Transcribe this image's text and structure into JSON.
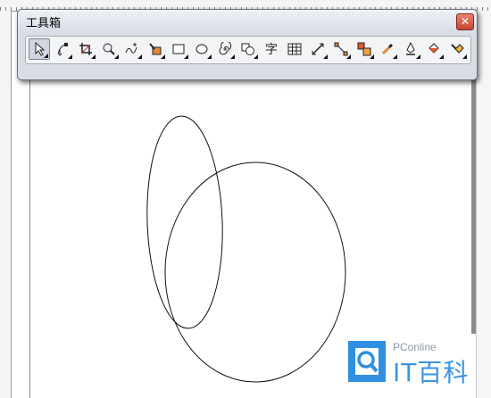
{
  "toolbox": {
    "title": "工具箱",
    "close_glyph": "✕",
    "text_tool_label": "字",
    "tools": [
      {
        "name": "pick-tool",
        "icon": "arrow-pointer-icon",
        "selected": true
      },
      {
        "name": "shape-tool",
        "icon": "shape-node-icon"
      },
      {
        "name": "crop-tool",
        "icon": "crop-icon"
      },
      {
        "name": "zoom-tool",
        "icon": "magnifier-icon"
      },
      {
        "name": "freehand-tool",
        "icon": "freehand-curve-icon"
      },
      {
        "name": "smart-fill-tool",
        "icon": "smart-fill-icon"
      },
      {
        "name": "rectangle-tool",
        "icon": "rectangle-icon"
      },
      {
        "name": "ellipse-tool",
        "icon": "ellipse-icon"
      },
      {
        "name": "spiral-tool",
        "icon": "spiral-icon"
      },
      {
        "name": "basic-shapes-tool",
        "icon": "basic-shapes-icon"
      },
      {
        "name": "text-tool",
        "icon": "text-icon"
      },
      {
        "name": "table-tool",
        "icon": "table-grid-icon"
      },
      {
        "name": "dimension-tool",
        "icon": "dimension-icon"
      },
      {
        "name": "connector-tool",
        "icon": "connector-icon"
      },
      {
        "name": "blend-tool",
        "icon": "blend-icon"
      },
      {
        "name": "eyedropper-tool",
        "icon": "eyedropper-icon"
      },
      {
        "name": "outline-pen-tool",
        "icon": "outline-pen-icon"
      },
      {
        "name": "fill-tool",
        "icon": "paint-bucket-icon"
      },
      {
        "name": "interactive-fill-tool",
        "icon": "interactive-fill-icon"
      }
    ]
  },
  "watermark": {
    "brand": "PConline",
    "name": "IT百科"
  },
  "colors": {
    "toolbox_bg": "#d8dde6",
    "close_button": "#c84632",
    "watermark_blue": "#2f8fe0"
  }
}
